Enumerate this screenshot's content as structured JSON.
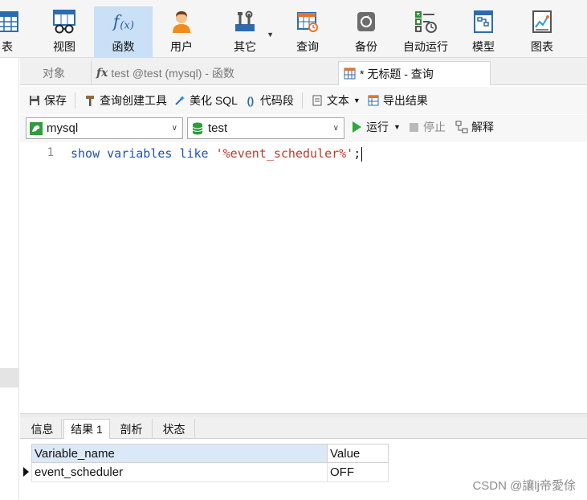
{
  "ribbon": {
    "items": [
      {
        "label": "表",
        "icon": "table-icon"
      },
      {
        "label": "视图",
        "icon": "view-icon"
      },
      {
        "label": "函数",
        "icon": "function-icon",
        "active": true
      },
      {
        "label": "用户",
        "icon": "user-icon"
      },
      {
        "label": "其它",
        "icon": "tools-icon"
      },
      {
        "label": "查询",
        "icon": "query-icon"
      },
      {
        "label": "备份",
        "icon": "backup-icon"
      },
      {
        "label": "自动运行",
        "icon": "schedule-icon"
      },
      {
        "label": "模型",
        "icon": "model-icon"
      },
      {
        "label": "图表",
        "icon": "chart-icon"
      }
    ]
  },
  "tabs": {
    "objects": "对象",
    "function_tab_symbol": "fx",
    "function_tab": "test @test (mysql) - 函数",
    "query_tab": "* 无标题 - 查询"
  },
  "toolbar": {
    "save": "保存",
    "query_builder": "查询创建工具",
    "beautify": "美化 SQL",
    "snippet": "代码段",
    "text": "文本",
    "export": "导出结果"
  },
  "selectors": {
    "connection": "mysql",
    "database": "test",
    "run": "运行",
    "stop": "停止",
    "explain": "解释"
  },
  "editor": {
    "line_number": "1",
    "tokens": {
      "show": "show",
      "variables": "variables",
      "like": "like",
      "literal": "'%event_scheduler%'",
      "semicolon": ";"
    }
  },
  "result": {
    "tabs": [
      "信息",
      "结果 1",
      "剖析",
      "状态"
    ],
    "active_tab_index": 1,
    "columns": [
      "Variable_name",
      "Value"
    ],
    "rows": [
      [
        "event_scheduler",
        "OFF"
      ]
    ]
  },
  "watermark": "CSDN @讓lj帝愛俆",
  "colors": {
    "keyword": "#1f4fbf",
    "string": "#c0392b",
    "active_ribbon": "#c9e0f7",
    "grid_header": "#dbe8f7"
  }
}
